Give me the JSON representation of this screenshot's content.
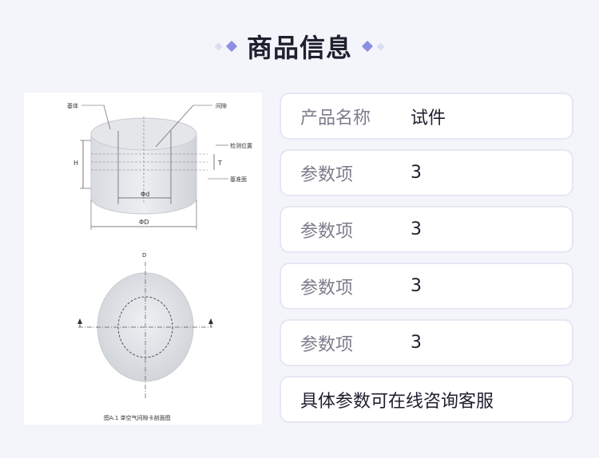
{
  "header": {
    "title": "商品信息"
  },
  "figure": {
    "labels": {
      "base": "基体",
      "gap": "间隙",
      "detect_position": "检测位置",
      "reference_plane": "基准面",
      "height": "H",
      "thickness": "T",
      "inner_diameter": "Φd",
      "outer_diameter": "ΦD",
      "d_mark": "D",
      "caption": "图A.1 单空气间隙卡剖面图"
    }
  },
  "specs": [
    {
      "label": "产品名称",
      "value": "试件"
    },
    {
      "label": "参数项",
      "value": "3"
    },
    {
      "label": "参数项",
      "value": "3"
    },
    {
      "label": "参数项",
      "value": "3"
    },
    {
      "label": "参数项",
      "value": "3"
    }
  ],
  "note": "具体参数可在线咨询客服"
}
